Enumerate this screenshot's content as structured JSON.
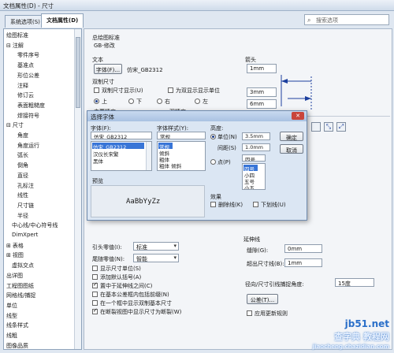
{
  "window": {
    "title": "文档属性(D) - 尺寸"
  },
  "tabs": [
    {
      "label": "系统选项(S)"
    },
    {
      "label": "文档属性(D)"
    }
  ],
  "search": {
    "placeholder": "搜索选项"
  },
  "tree": [
    {
      "label": "绘图标准",
      "level": 0,
      "expander": ""
    },
    {
      "label": "注解",
      "level": 0,
      "expander": "⊟"
    },
    {
      "label": "零件序号",
      "level": 2,
      "expander": ""
    },
    {
      "label": "基准点",
      "level": 2,
      "expander": ""
    },
    {
      "label": "形位公差",
      "level": 2,
      "expander": ""
    },
    {
      "label": "注释",
      "level": 2,
      "expander": ""
    },
    {
      "label": "修订云",
      "level": 2,
      "expander": ""
    },
    {
      "label": "表面粗糙度",
      "level": 2,
      "expander": ""
    },
    {
      "label": "焊接符号",
      "level": 2,
      "expander": ""
    },
    {
      "label": "尺寸",
      "level": 0,
      "expander": "⊟"
    },
    {
      "label": "角度",
      "level": 2,
      "expander": ""
    },
    {
      "label": "角度运行",
      "level": 2,
      "expander": ""
    },
    {
      "label": "弧长",
      "level": 2,
      "expander": ""
    },
    {
      "label": "倒角",
      "level": 2,
      "expander": ""
    },
    {
      "label": "直径",
      "level": 2,
      "expander": ""
    },
    {
      "label": "孔标注",
      "level": 2,
      "expander": ""
    },
    {
      "label": "线性",
      "level": 2,
      "expander": ""
    },
    {
      "label": "尺寸链",
      "level": 2,
      "expander": ""
    },
    {
      "label": "半径",
      "level": 2,
      "expander": ""
    },
    {
      "label": "中心线/中心符号线",
      "level": 1,
      "expander": ""
    },
    {
      "label": "DimXpert",
      "level": 1,
      "expander": ""
    },
    {
      "label": "表格",
      "level": 0,
      "expander": "⊞"
    },
    {
      "label": "视图",
      "level": 0,
      "expander": "⊞"
    },
    {
      "label": "虚拟交点",
      "level": 1,
      "expander": ""
    },
    {
      "label": "出详图",
      "level": 0,
      "expander": ""
    },
    {
      "label": "工程图图纸",
      "level": 0,
      "expander": ""
    },
    {
      "label": "网格线/捕捉",
      "level": 0,
      "expander": ""
    },
    {
      "label": "单位",
      "level": 0,
      "expander": ""
    },
    {
      "label": "线型",
      "level": 0,
      "expander": ""
    },
    {
      "label": "线条样式",
      "level": 0,
      "expander": ""
    },
    {
      "label": "线粗",
      "level": 0,
      "expander": ""
    },
    {
      "label": "图像品质",
      "level": 0,
      "expander": ""
    }
  ],
  "main": {
    "overall_standard_label": "总绘图标准",
    "overall_standard_value": "GB-修改",
    "text_label": "文本",
    "font_button": "字体(F)...",
    "font_value": "仿宋_GB2312",
    "dual_label": "双制尺寸",
    "dual_display": "双制尺寸显示(U)",
    "dual_units": "为双显示显示单位",
    "pos_top": "上",
    "pos_bottom": "下",
    "pos_right": "右",
    "pos_left": "左",
    "primary_precision": "主要精度",
    "dual_precision": "双精度",
    "arrow_label": "箭头",
    "arrow_val1": "1mm",
    "arrow_val2": "3mm",
    "arrow_val3": "6mm",
    "leader_zero_label": "引头零值(I):",
    "leader_zero_value": "标准",
    "trailing_zero_label": "尾随零值(N):",
    "trailing_zero_value": "智能",
    "opt_units": "显示尺寸单位(S)",
    "opt_parens": "添加默认括号(A)",
    "opt_center": "置中于延伸线之间(C)",
    "opt_basic_tol": "在基本公差框内包括前缀(N)",
    "opt_single_box": "在一个框中显示双制基本尺寸",
    "opt_broken": "在断裂视图中显示尺寸为断裂(W)",
    "extension_label": "延伸线",
    "gap_label": "缝隙(G):",
    "gap_value": "0mm",
    "beyond_label": "超出尺寸线(B):",
    "beyond_value": "1mm",
    "radial_label": "径向/尺寸引线捕捉角度:",
    "radial_value": "15度",
    "tolerance_button": "公差(T)...",
    "apply_update": "应用更新规则"
  },
  "dialog": {
    "title": "选择字体",
    "font_label": "字体(F):",
    "font_value": "仿宋_GB2312",
    "font_list": [
      "仿宋_GB2312",
      "汉仪长宋繁",
      "黑体"
    ],
    "style_label": "字体样式(Y):",
    "style_value": "常规",
    "style_list": [
      "常规",
      "倾斜",
      "粗体",
      "粗体 倾斜"
    ],
    "height_label": "高度:",
    "unit_label": "单位(N)",
    "unit_value": "3.5mm",
    "spacing_label": "间距(S)",
    "spacing_value": "1.0mm",
    "points_label": "点(P)",
    "points_value": "四号",
    "size_list": [
      "四号",
      "小四",
      "五号",
      "小五"
    ],
    "ok": "确定",
    "cancel": "取消",
    "preview_label": "预览",
    "preview_text": "AaBbYyZz",
    "effects_label": "效果",
    "strike": "删除线(K)",
    "underline": "下划线(U)"
  },
  "watermark": {
    "line1": "jb51.net",
    "line2": "查字典 教程网",
    "line3": "jiaocheng.chazidian.com"
  }
}
